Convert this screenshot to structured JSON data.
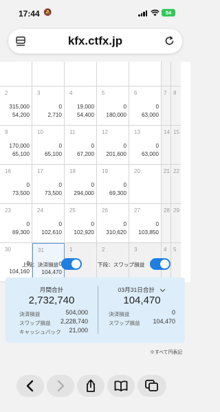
{
  "status": {
    "time": "17:44",
    "mute_glyph": "🔕",
    "battery": "54"
  },
  "browser": {
    "url": "kfx.ctfx.jp"
  },
  "calendar": {
    "rows": [
      [
        {
          "day": "",
          "v1": "",
          "v2": ""
        },
        {
          "day": "",
          "v1": "",
          "v2": ""
        },
        {
          "day": "",
          "v1": "",
          "v2": ""
        },
        {
          "day": "",
          "v1": "",
          "v2": ""
        },
        {
          "day": "",
          "v1": "",
          "v2": ""
        },
        {
          "day": "",
          "v1": "",
          "v2": ""
        },
        {
          "day": "",
          "v1": "",
          "v2": ""
        }
      ],
      [
        {
          "day": "2",
          "v1": "315,000",
          "v2": "54,200"
        },
        {
          "day": "3",
          "v1": "0",
          "v2": "2,710"
        },
        {
          "day": "4",
          "v1": "19,000",
          "v2": "54,400"
        },
        {
          "day": "5",
          "v1": "0",
          "v2": "180,000"
        },
        {
          "day": "6",
          "v1": "0",
          "v2": "63,000"
        },
        {
          "day": "7",
          "v1": "",
          "v2": ""
        },
        {
          "day": "8",
          "v1": "",
          "v2": ""
        }
      ],
      [
        {
          "day": "9",
          "v1": "170,000",
          "v2": "65,100"
        },
        {
          "day": "10",
          "v1": "0",
          "v2": "65,100"
        },
        {
          "day": "11",
          "v1": "0",
          "v2": "67,200"
        },
        {
          "day": "12",
          "v1": "0",
          "v2": "201,600"
        },
        {
          "day": "13",
          "v1": "0",
          "v2": "63,000"
        },
        {
          "day": "14",
          "v1": "",
          "v2": ""
        },
        {
          "day": "15",
          "v1": "",
          "v2": ""
        }
      ],
      [
        {
          "day": "16",
          "v1": "0",
          "v2": "73,500"
        },
        {
          "day": "17",
          "v1": "0",
          "v2": "73,500"
        },
        {
          "day": "18",
          "v1": "0",
          "v2": "294,000"
        },
        {
          "day": "19",
          "v1": "0",
          "v2": "69,300"
        },
        {
          "day": "20",
          "v1": "",
          "v2": ""
        },
        {
          "day": "21",
          "v1": "",
          "v2": ""
        },
        {
          "day": "22",
          "v1": "",
          "v2": ""
        }
      ],
      [
        {
          "day": "23",
          "v1": "0",
          "v2": "69,300"
        },
        {
          "day": "24",
          "v1": "0",
          "v2": "102,610"
        },
        {
          "day": "25",
          "v1": "0",
          "v2": "102,920"
        },
        {
          "day": "26",
          "v1": "0",
          "v2": "310,620"
        },
        {
          "day": "27",
          "v1": "0",
          "v2": "103,850"
        },
        {
          "day": "28",
          "v1": "",
          "v2": ""
        },
        {
          "day": "29",
          "v1": "",
          "v2": ""
        }
      ],
      [
        {
          "day": "30",
          "v1": "0",
          "v2": "104,160"
        },
        {
          "day": "31",
          "v1": "0",
          "v2": "104,470"
        },
        {
          "day": "1",
          "v1": "",
          "v2": ""
        },
        {
          "day": "2",
          "v1": "",
          "v2": ""
        },
        {
          "day": "3",
          "v1": "",
          "v2": ""
        },
        {
          "day": "4",
          "v1": "",
          "v2": ""
        },
        {
          "day": "5",
          "v1": "",
          "v2": ""
        }
      ]
    ]
  },
  "toggles": {
    "upper_label": "上段：決済損益",
    "lower_label": "下段：スワップ損益",
    "upper_on": true,
    "lower_on": true,
    "accent": "#1e7fe0"
  },
  "summary": {
    "monthly_title": "月間合計",
    "monthly_total": "2,732,740",
    "monthly_lines": [
      {
        "label": "決済損益",
        "value": "504,000"
      },
      {
        "label": "スワップ損益",
        "value": "2,228,740"
      },
      {
        "label": "キャッシュバック",
        "value": "21,000"
      }
    ],
    "daily_title": "03月31日合計",
    "daily_total": "104,470",
    "daily_lines": [
      {
        "label": "決済損益",
        "value": "0"
      },
      {
        "label": "スワップ損益",
        "value": "104,470"
      }
    ],
    "note": "※すべて円表記"
  }
}
